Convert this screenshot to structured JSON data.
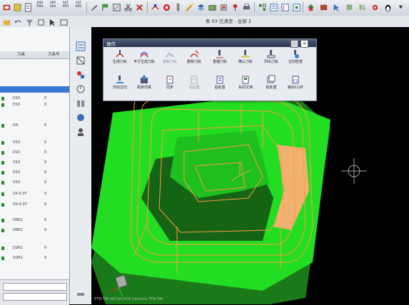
{
  "toolbar": {
    "text_buttons": [
      "DSR",
      "GRP",
      "SET",
      "CUT",
      "DRL"
    ],
    "text_buttons_sub": [
      "TOOL",
      "GEO",
      "MTH",
      "WZD",
      "PRG"
    ]
  },
  "window": {
    "title": "条 03 已清定 - 全部 2"
  },
  "left_panel": {
    "headers": [
      "刀具",
      "刀具号"
    ],
    "rows": [
      {
        "name": "D10",
        "num": "0"
      },
      {
        "name": "D10",
        "num": "0"
      },
      {
        "name": "D4",
        "num": "0"
      },
      {
        "name": "D10",
        "num": "0"
      },
      {
        "name": "D10",
        "num": "0"
      },
      {
        "name": "D10",
        "num": "0"
      },
      {
        "name": "D10",
        "num": "0"
      },
      {
        "name": "D10",
        "num": "0"
      },
      {
        "name": "D4-0.07",
        "num": "0"
      },
      {
        "name": "D4-0.07",
        "num": "0"
      },
      {
        "name": "D6R2",
        "num": "0"
      },
      {
        "name": "D6R2",
        "num": "0"
      },
      {
        "name": "D2R1",
        "num": "0"
      },
      {
        "name": "D2R1",
        "num": "0"
      }
    ]
  },
  "dialog": {
    "title": "操作",
    "close_label": "×",
    "items": [
      {
        "label": "生成刀轨",
        "icon": "generate-icon",
        "enabled": true
      },
      {
        "label": "平行生成刀轨",
        "icon": "parallel-generate-icon",
        "enabled": true
      },
      {
        "label": "编辑刀轨",
        "icon": "edit-path-icon",
        "enabled": false
      },
      {
        "label": "删除刀轨",
        "icon": "delete-path-icon",
        "enabled": true
      },
      {
        "label": "重播刀轨",
        "icon": "replay-icon",
        "enabled": true
      },
      {
        "label": "确认刀轨",
        "icon": "verify-icon",
        "enabled": true
      },
      {
        "label": "列出刀轨",
        "icon": "list-icon",
        "enabled": true
      },
      {
        "label": "过切检查",
        "icon": "gouge-check-icon",
        "enabled": true
      },
      {
        "label": "列出过切",
        "icon": "list-gouge-icon",
        "enabled": true
      },
      {
        "label": "机床仿真",
        "icon": "machine-sim-icon",
        "enabled": true
      },
      {
        "label": "同步",
        "icon": "sync-icon",
        "enabled": true
      },
      {
        "label": "后处理",
        "icon": "postprocess-icon",
        "enabled": false
      },
      {
        "label": "后处理",
        "icon": "postprocess2-icon",
        "enabled": true
      },
      {
        "label": "车间文档",
        "icon": "shop-doc-icon",
        "enabled": true
      },
      {
        "label": "批处理",
        "icon": "batch-icon",
        "enabled": true
      },
      {
        "label": "输出CLSF",
        "icon": "output-clsf-icon",
        "enabled": true
      }
    ]
  },
  "viewport": {
    "status": "TFR-TRI WCS/CSYS Camera TFR-TRI"
  },
  "colors": {
    "model_green": "#22dd22",
    "model_dark": "#1a7a1a",
    "toolpath": "#ff9a40",
    "dialog_title": "#2b3650",
    "selection": "#3a78d8"
  }
}
